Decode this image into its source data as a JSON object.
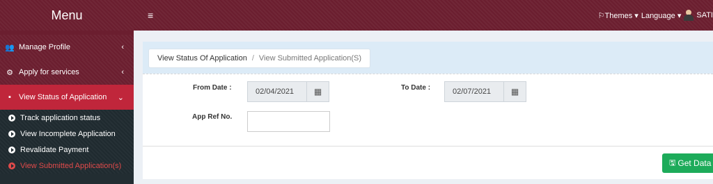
{
  "sidebar": {
    "title": "Menu",
    "items": [
      {
        "label": "Manage Profile",
        "icon": "group-icon",
        "glyph": "👥",
        "arrow": "‹"
      },
      {
        "label": "Apply for services",
        "icon": "cogs-icon",
        "glyph": "⚙",
        "arrow": "‹"
      },
      {
        "label": "View Status of Application",
        "icon": "list-box-icon",
        "glyph": "▪",
        "arrow": "⌄"
      }
    ],
    "subitems": [
      {
        "label": "Track application status"
      },
      {
        "label": "View Incomplete Application"
      },
      {
        "label": "Revalidate Payment"
      },
      {
        "label": "View Submitted Application(s)"
      }
    ]
  },
  "topbar": {
    "menu_glyph": "≡",
    "themes": "⚐Themes ▾",
    "language": "Language ▾",
    "user": "SATI"
  },
  "breadcrumb": {
    "parent": "View Status Of Application",
    "separator": "/",
    "current": "View Submitted Application(S)"
  },
  "form": {
    "from_label": "From Date :",
    "from_value": "02/04/2021",
    "to_label": "To Date :",
    "to_value": "02/07/2021",
    "ref_label": "App Ref No.",
    "ref_value": "",
    "calendar_glyph": "▦"
  },
  "actions": {
    "get_data_label": "Get Data",
    "save_glyph": "🖫"
  },
  "colors": {
    "brand": "#6b1e2f",
    "active": "#c0263b",
    "success": "#1dab5a"
  }
}
